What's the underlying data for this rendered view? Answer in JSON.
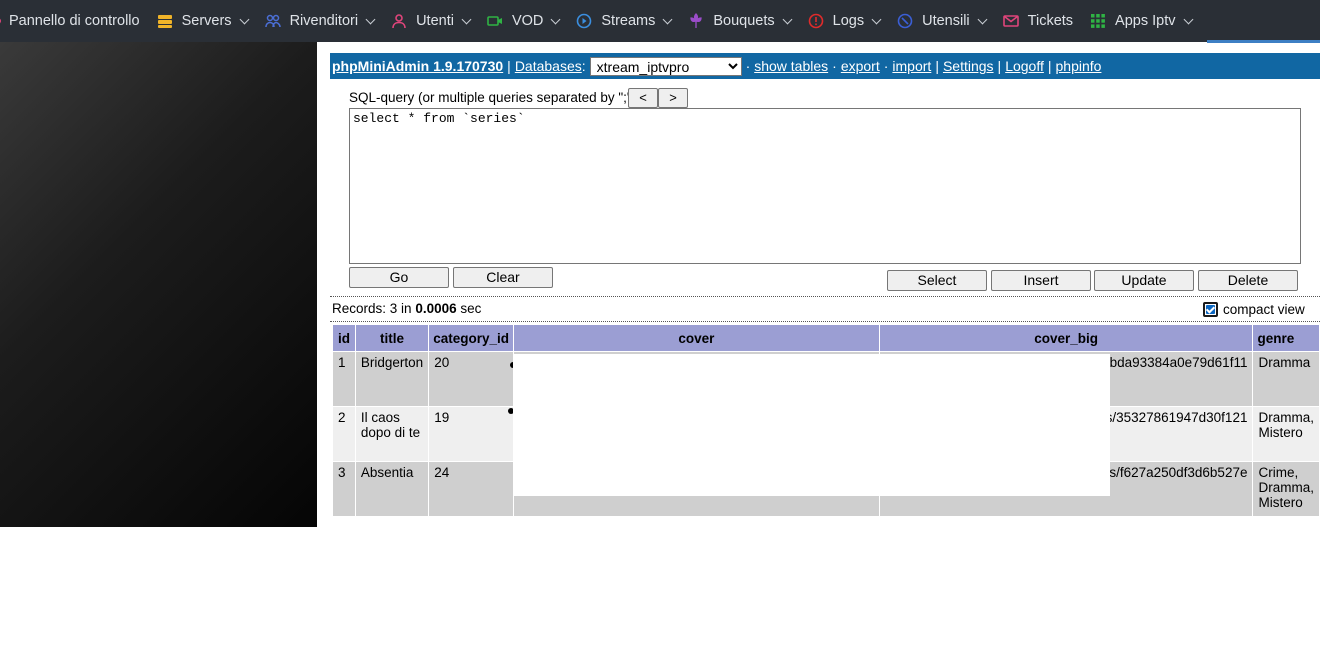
{
  "nav": {
    "items": [
      {
        "label": "Pannello di controllo",
        "icon": "dashboard-icon",
        "color": "#e0457b",
        "dropdown": false
      },
      {
        "label": "Servers",
        "icon": "server-icon",
        "color": "#f0b429",
        "dropdown": true
      },
      {
        "label": "Rivenditori",
        "icon": "users-icon",
        "color": "#4b6fd6",
        "dropdown": true
      },
      {
        "label": "Utenti",
        "icon": "user-icon",
        "color": "#e0457b",
        "dropdown": true
      },
      {
        "label": "VOD",
        "icon": "video-icon",
        "color": "#2fb344",
        "dropdown": true
      },
      {
        "label": "Streams",
        "icon": "play-circle-icon",
        "color": "#3b8fe0",
        "dropdown": true
      },
      {
        "label": "Bouquets",
        "icon": "flower-icon",
        "color": "#9b4dca",
        "dropdown": true
      },
      {
        "label": "Logs",
        "icon": "alert-icon",
        "color": "#e02b2b",
        "dropdown": true
      },
      {
        "label": "Utensili",
        "icon": "tools-icon",
        "color": "#3b5fd6",
        "dropdown": true
      },
      {
        "label": "Tickets",
        "icon": "mail-icon",
        "color": "#e0457b",
        "dropdown": false
      },
      {
        "label": "Apps Iptv",
        "icon": "grid-icon",
        "color": "#2fb344",
        "dropdown": true
      }
    ]
  },
  "header": {
    "app_name": "phpMiniAdmin 1.9.170730",
    "databases_label": "Databases",
    "selected_db": "xtream_iptvpro",
    "show_tables": "show tables",
    "export": "export",
    "import": "import",
    "settings": "Settings",
    "logoff": "Logoff",
    "phpinfo": "phpinfo"
  },
  "query": {
    "label": "SQL-query (or multiple queries separated by \";\"):",
    "prev": "<",
    "next": ">",
    "text": "select * from `series`",
    "go": "Go",
    "clear": "Clear",
    "select": "Select",
    "insert": "Insert",
    "update": "Update",
    "delete": "Delete"
  },
  "results": {
    "records_label": "Records: ",
    "records_count": "3",
    "in_label": " in ",
    "time": "0.0006",
    "sec_label": " sec",
    "compact_view": "compact view",
    "compact_checked": true,
    "columns": [
      "id",
      "title",
      "category_id",
      "cover",
      "cover_big",
      "genre"
    ],
    "rows": [
      {
        "id": "1",
        "title": "Bridgerton",
        "category_id": "20",
        "cover": "",
        "cover_big": "b81c5bda93384a0e79d61f11",
        "genre": "Dramma"
      },
      {
        "id": "2",
        "title": "Il caos dopo di te",
        "category_id": "19",
        "cover": "",
        "cover_big": "images/35327861947d30f121",
        "genre": "Dramma, Mistero"
      },
      {
        "id": "3",
        "title": "Absentia",
        "category_id": "24",
        "cover": "",
        "cover_big": "images/f627a250df3d6b527e",
        "genre": "Crime, Dramma, Mistero"
      }
    ]
  }
}
